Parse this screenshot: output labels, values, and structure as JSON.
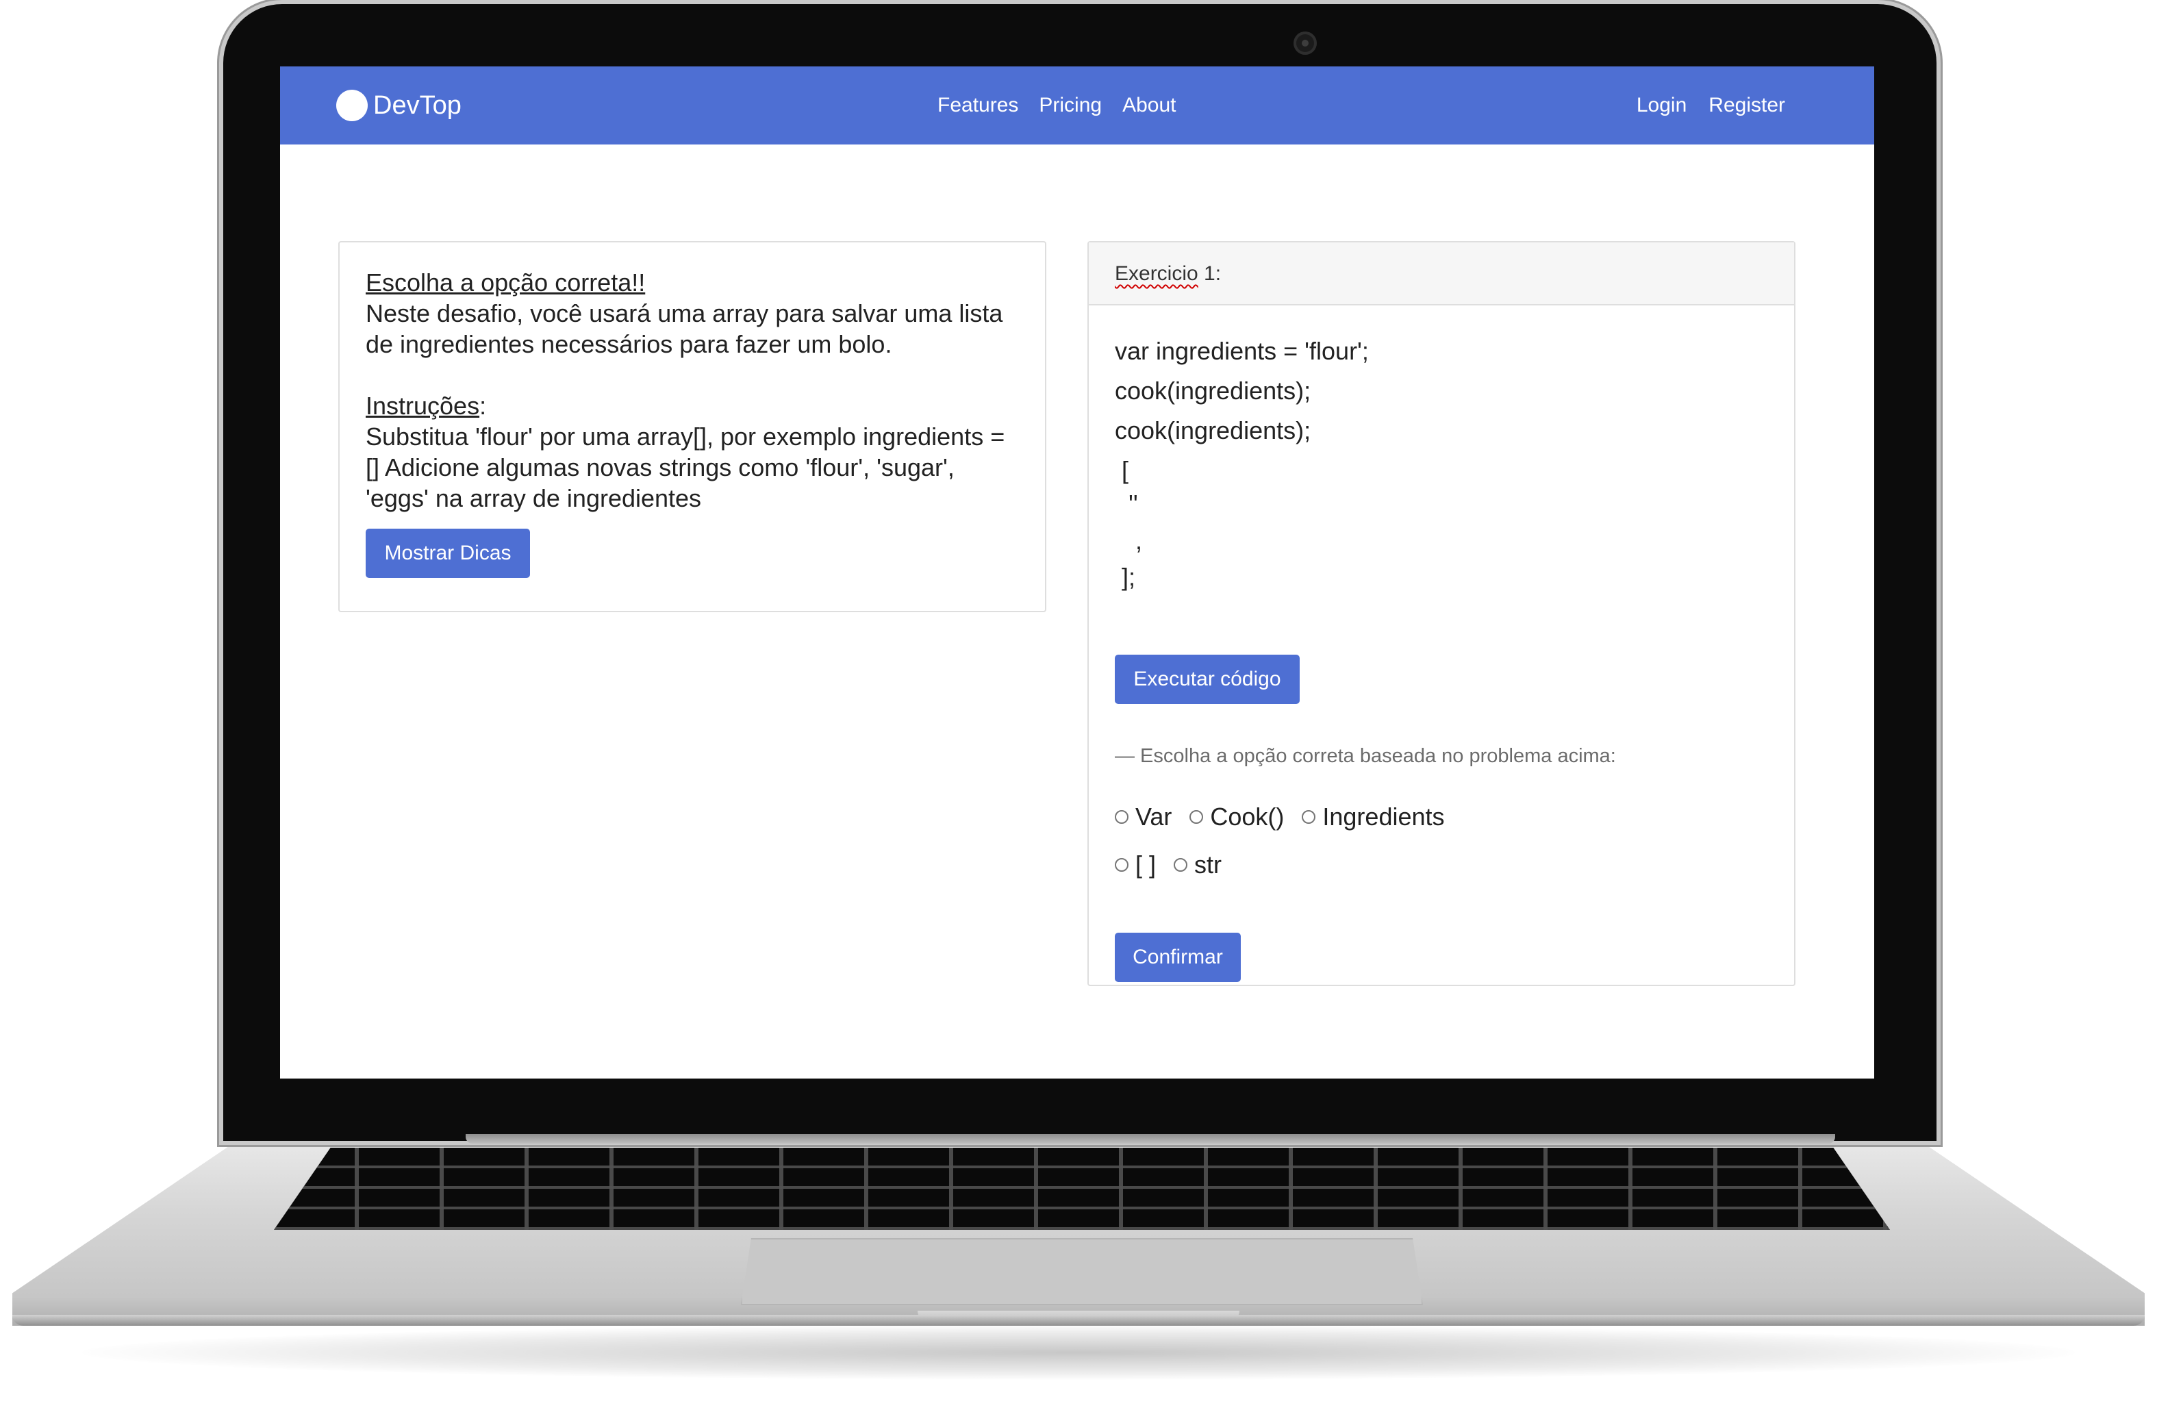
{
  "navbar": {
    "brand": "DevTop",
    "links": [
      "Features",
      "Pricing",
      "About"
    ],
    "auth": [
      "Login",
      "Register"
    ]
  },
  "intro": {
    "title": "Escolha a opção correta!!",
    "description": "Neste desafio, você usará uma array para salvar uma lista de ingredientes necessários para fazer um bolo.",
    "instructions_label": "Instruções",
    "instructions_colon": ":",
    "instructions_text": "Substitua 'flour' por uma array[], por exemplo ingredients = [] Adicione algumas novas strings como 'flour', 'sugar', 'eggs' na array de ingredientes",
    "hints_button": "Mostrar Dicas"
  },
  "exercise": {
    "header_word": "Exercicio",
    "header_rest": " 1:",
    "code_lines": [
      "var ingredients = 'flour';",
      "cook(ingredients);",
      "cook(ingredients);",
      " [",
      "  ''",
      "   ,",
      " ];"
    ],
    "run_button": "Executar código",
    "question": "— Escolha a opção correta baseada no problema acima:",
    "options": [
      "Var",
      "Cook()",
      "Ingredients",
      "[ ]",
      "str"
    ],
    "confirm_button": "Confirmar"
  },
  "colors": {
    "accent": "#4e6fd3",
    "card_border": "#dedede",
    "header_bg": "#f6f6f6"
  }
}
